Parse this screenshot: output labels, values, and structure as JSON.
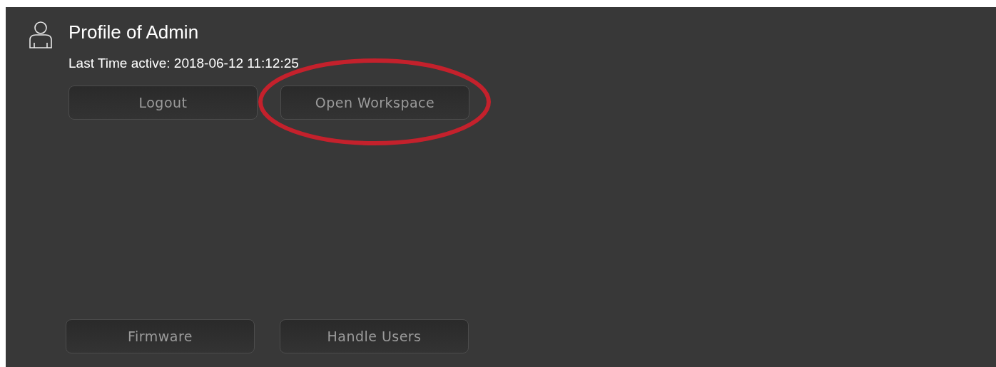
{
  "profile": {
    "title": "Profile of Admin",
    "last_active": "Last Time active: 2018-06-12 11:12:25"
  },
  "top_buttons": [
    "Logout",
    "Open Workspace"
  ],
  "bottom_buttons": [
    "Firmware",
    "Handle Users"
  ],
  "annotation": {
    "kind": "ellipse",
    "color": "#c4212c"
  }
}
